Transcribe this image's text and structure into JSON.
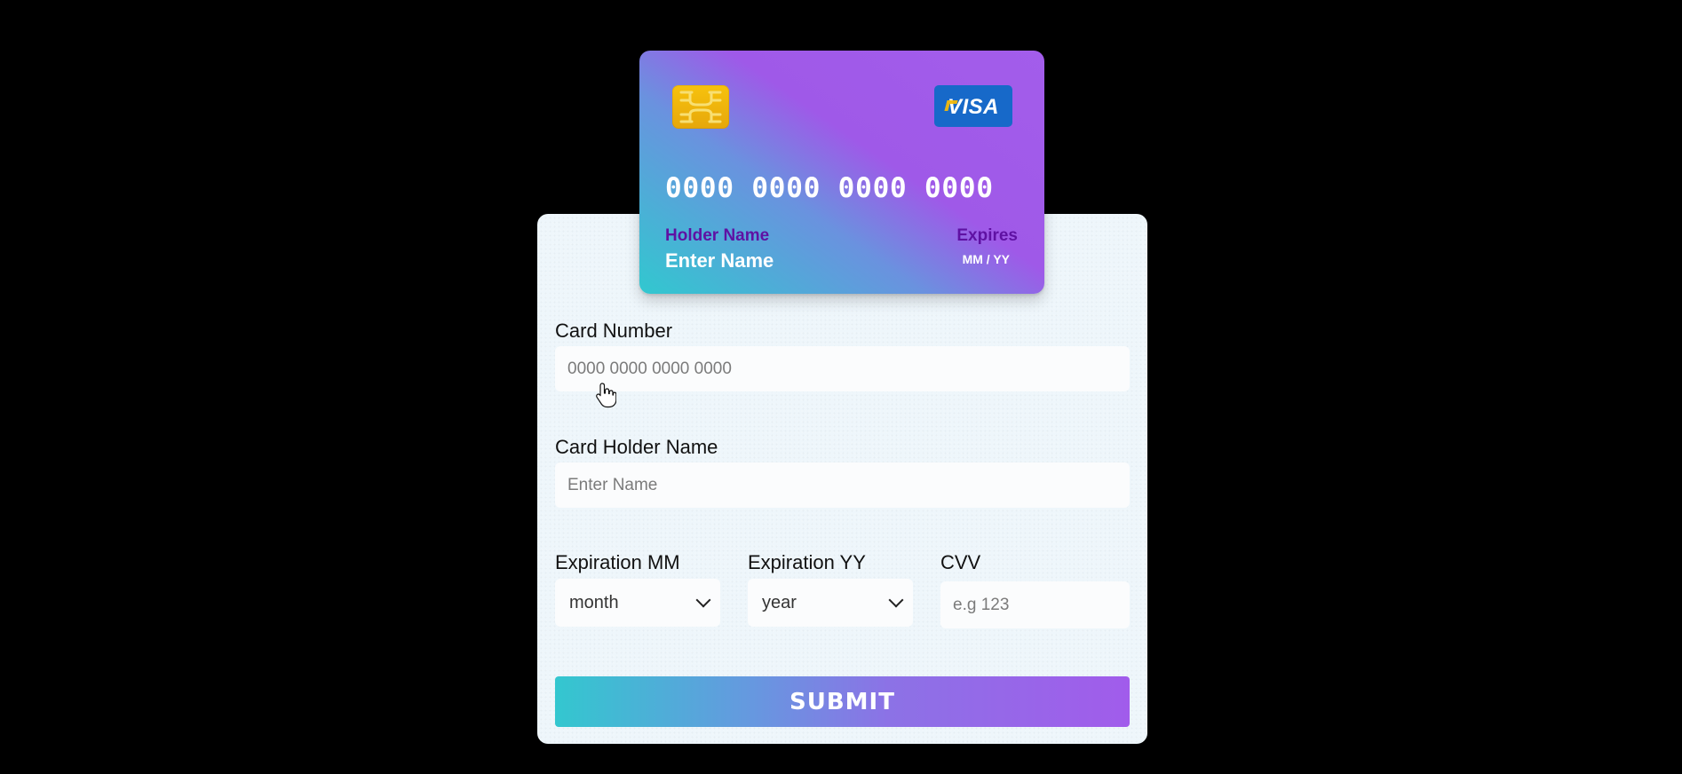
{
  "card_preview": {
    "number": "0000 0000 0000 0000",
    "holder_label": "Holder Name",
    "holder_value": "Enter Name",
    "expires_label": "Expires",
    "expires_value": "MM / YY",
    "brand": "VISA"
  },
  "form": {
    "card_number": {
      "label": "Card Number",
      "placeholder": "0000 0000 0000 0000"
    },
    "card_holder_name": {
      "label": "Card Holder Name",
      "placeholder": "Enter Name"
    },
    "expiration_mm": {
      "label": "Expiration MM",
      "selected": "month"
    },
    "expiration_yy": {
      "label": "Expiration YY",
      "selected": "year"
    },
    "cvv": {
      "label": "CVV",
      "placeholder": "e.g 123"
    },
    "submit_label": "SUBMIT"
  },
  "colors": {
    "page_background": "#000000",
    "panel_background": "#eef6fb",
    "card_gradient_start": "#31c8cf",
    "card_gradient_mid": "#6a92df",
    "card_gradient_end": "#a35deb",
    "visa_blue": "#1769c9",
    "label_purple": "#5f11a3",
    "button_gradient_start": "#33c7cf",
    "button_gradient_end": "#a15ceb"
  },
  "icons": {
    "chip": "card-chip-icon",
    "brand": "visa-logo-icon",
    "pointer": "hand-pointer-icon",
    "dropdown": "chevron-down-icon"
  }
}
